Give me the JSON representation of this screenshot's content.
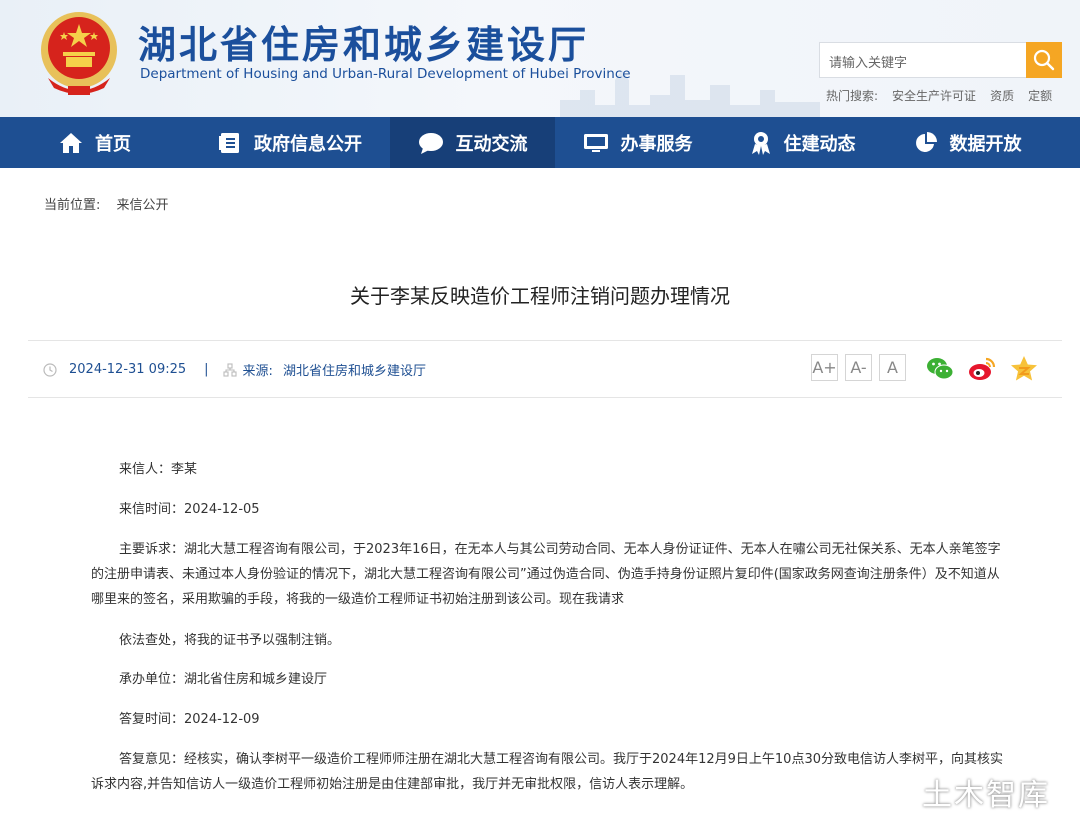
{
  "site": {
    "title": "湖北省住房和城乡建设厅",
    "subtitle": "Department of Housing and Urban-Rural Development of Hubei Province"
  },
  "search": {
    "placeholder": "请输入关键字",
    "hot_label": "热门搜索:",
    "hot_terms": [
      "安全生产许可证",
      "资质",
      "定额"
    ]
  },
  "nav": [
    {
      "label": "首页",
      "icon": "home-icon"
    },
    {
      "label": "政府信息公开",
      "icon": "document-icon"
    },
    {
      "label": "互动交流",
      "icon": "chat-bubble-icon",
      "active": true
    },
    {
      "label": "办事服务",
      "icon": "monitor-icon"
    },
    {
      "label": "住建动态",
      "icon": "badge-icon"
    },
    {
      "label": "数据开放",
      "icon": "pie-chart-icon"
    }
  ],
  "breadcrumb": {
    "label": "当前位置:",
    "current": "来信公开"
  },
  "article": {
    "title": "关于李某反映造价工程师注销问题办理情况",
    "date": "2024-12-31 09:25",
    "source_label": "来源:",
    "source": "湖北省住房和城乡建设厅",
    "font_sizes": [
      "A+",
      "A-",
      "A"
    ],
    "letter_from": "来信人：李某",
    "letter_date": "来信时间：2024-12-05",
    "complaint": "主要诉求：湖北大慧工程咨询有限公司，于2023年16日，在无本人与其公司劳动合同、无本人身份证证件、无本人在嘯公司无社保关系、无本人亲笔签字的注册申请表、未通过本人身份验证的情况下，湖北大慧工程咨询有限公司”通过伪造合同、伪造手持身份证照片复印件(国家政务网查询注册条件）及不知道从哪里来的签名，采用欺骗的手段，将我的一级造价工程师证书初始注册到该公司。现在我请求",
    "request": "依法查处，将我的证书予以强制注销。",
    "handler": "承办单位：湖北省住房和城乡建设厅",
    "reply_date": "答复时间：2024-12-09",
    "reply": "答复意见：经核实，确认李树平一级造价工程师师注册在湖北大慧工程咨询有限公司。我厅于2024年12月9日上午10点30分致电信访人李树平，向其核实诉求内容,并告知信访人一级造价工程师初始注册是由住建部审批，我厅并无审批权限，信访人表示理解。"
  },
  "watermark": "土木智库",
  "colors": {
    "nav": "#1e4f92",
    "nav_active": "#173f78",
    "search_button": "#f5a623",
    "title_blue": "#1b4f9c"
  }
}
